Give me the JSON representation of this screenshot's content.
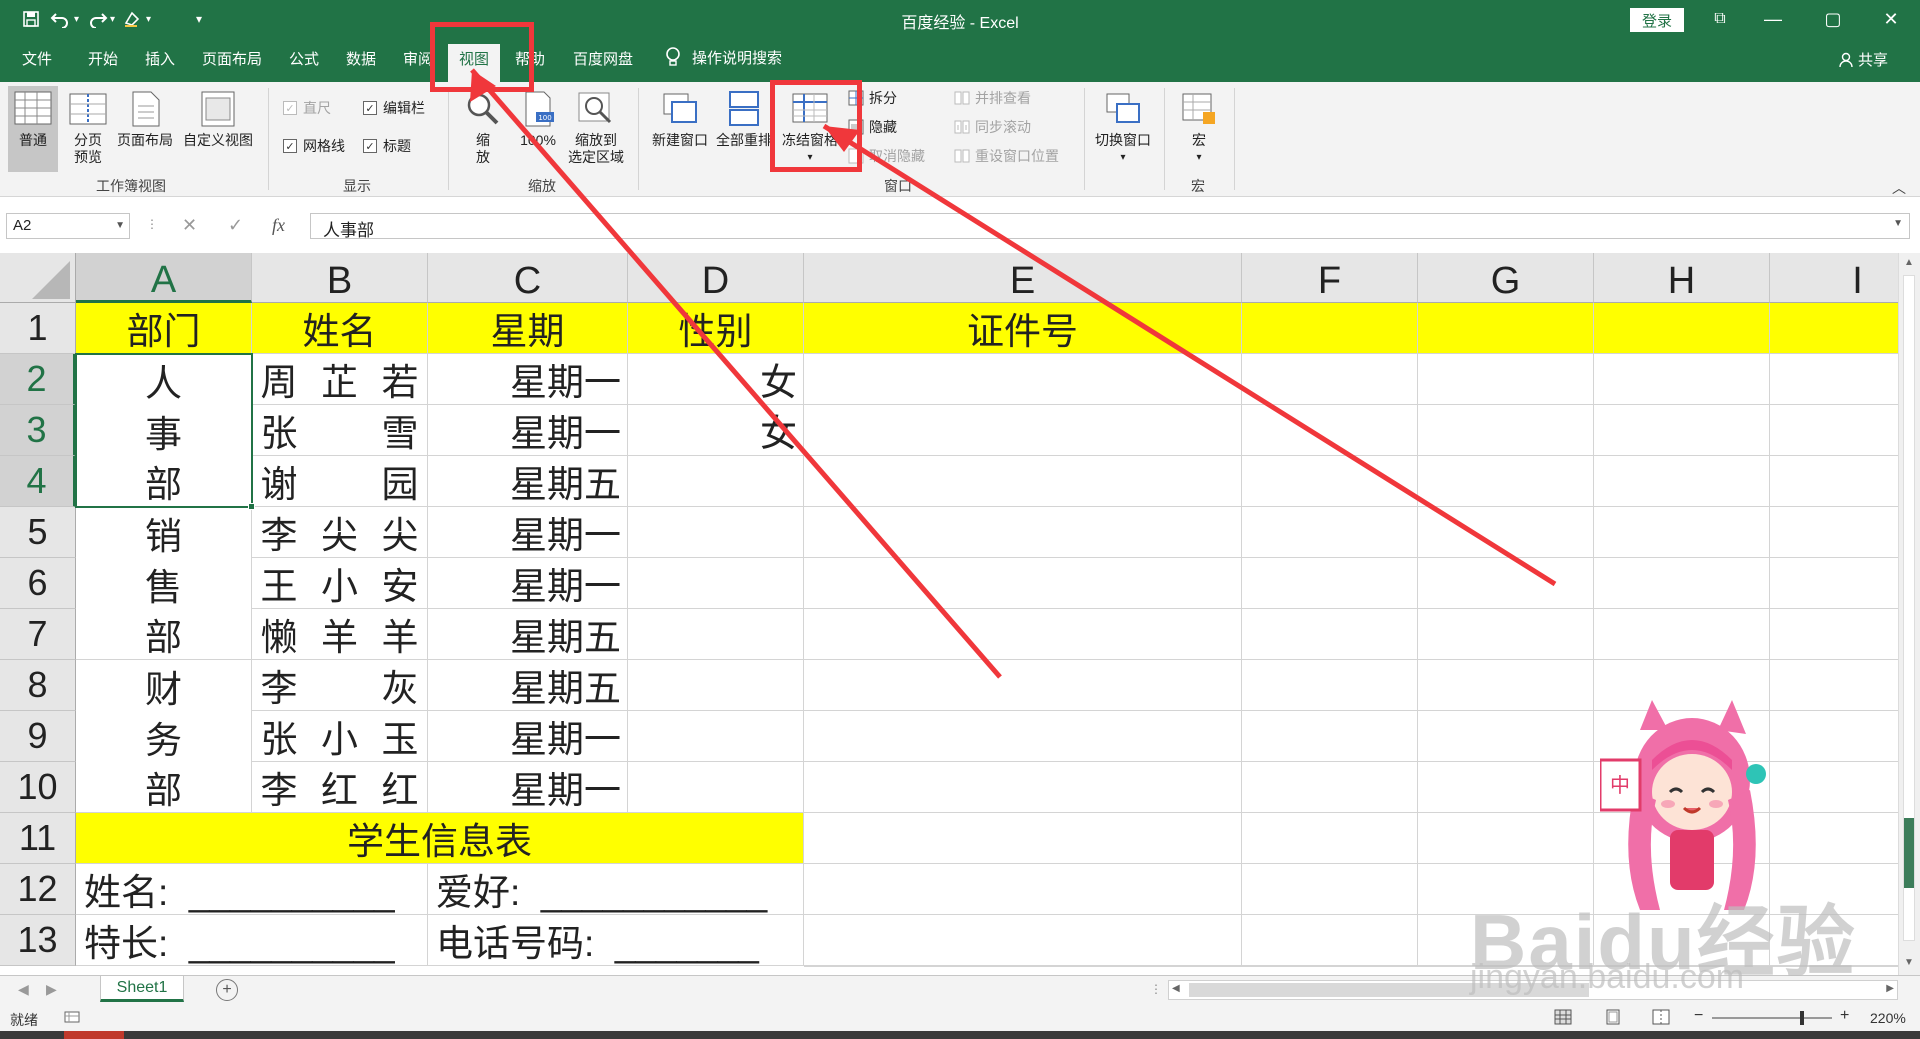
{
  "titlebar": {
    "doc_title": "百度经验  -  Excel",
    "login_label": "登录",
    "restore_icon": "⧉",
    "minimize_icon": "—",
    "maximize_icon": "▢",
    "close_icon": "✕"
  },
  "tabs": {
    "file": "文件",
    "home": "开始",
    "insert": "插入",
    "page_layout": "页面布局",
    "formulas": "公式",
    "data": "数据",
    "review": "审阅",
    "view": "视图",
    "help": "帮助",
    "baidu_pan": "百度网盘",
    "tell_me": "操作说明搜索",
    "share": "共享"
  },
  "ribbon": {
    "workbook_views": {
      "normal": "普通",
      "page_break_line1": "分页",
      "page_break_line2": "预览",
      "page_layout": "页面布局",
      "custom_views": "自定义视图",
      "group_label": "工作簿视图"
    },
    "show": {
      "ruler": "直尺",
      "formula_bar": "编辑栏",
      "gridlines": "网格线",
      "headings": "标题",
      "group_label": "显示"
    },
    "zoom": {
      "zoom_line1": "缩",
      "zoom_line2": "放",
      "hundred": "100%",
      "zoom_sel_line1": "缩放到",
      "zoom_sel_line2": "选定区域",
      "group_label": "缩放"
    },
    "window": {
      "new_window": "新建窗口",
      "arrange_all": "全部重排",
      "freeze_panes": "冻结窗格",
      "split": "拆分",
      "hide": "隐藏",
      "unhide": "取消隐藏",
      "side_by_side": "并排查看",
      "sync_scroll": "同步滚动",
      "reset_position": "重设窗口位置",
      "switch_windows": "切换窗口",
      "group_label": "窗口"
    },
    "macros": {
      "macros": "宏",
      "group_label": "宏"
    }
  },
  "formula_bar": {
    "name_box": "A2",
    "cancel_icon": "✕",
    "enter_icon": "✓",
    "fx_icon": "fx",
    "content": "人事部"
  },
  "sheet": {
    "columns": [
      "A",
      "B",
      "C",
      "D",
      "E",
      "F",
      "G",
      "H",
      "I"
    ],
    "rows": [
      "1",
      "2",
      "3",
      "4",
      "5",
      "6",
      "7",
      "8",
      "9",
      "10",
      "11",
      "12",
      "13"
    ],
    "header": {
      "a": "部门",
      "b": "姓名",
      "c": "星期",
      "d": "性别",
      "e": "证件号"
    },
    "dept_chars": [
      "人",
      "事",
      "部",
      "销",
      "售",
      "部",
      "财",
      "务",
      "部"
    ],
    "names": [
      [
        "周",
        "芷",
        "若"
      ],
      [
        "张",
        "",
        "雪"
      ],
      [
        "谢",
        "",
        "园"
      ],
      [
        "李",
        "尖",
        "尖"
      ],
      [
        "王",
        "小",
        "安"
      ],
      [
        "懒",
        "羊",
        "羊"
      ],
      [
        "李",
        "",
        "灰"
      ],
      [
        "张",
        "小",
        "玉"
      ],
      [
        "李",
        "红",
        "红"
      ]
    ],
    "weekdays": [
      "星期一",
      "星期一",
      "星期五",
      "星期一",
      "星期一",
      "星期五",
      "星期五",
      "星期一",
      "星期一"
    ],
    "genders": [
      "女",
      "女",
      "",
      "",
      "",
      "",
      "",
      "",
      ""
    ],
    "row11_title": "学生信息表",
    "row12_left": "姓名:  __________",
    "row12_right": "爱好:  ___________",
    "row13_left": "特长:  __________",
    "row13_right": "电话号码:  _______"
  },
  "sheet_tabs": {
    "sheet1": "Sheet1",
    "add": "+"
  },
  "status": {
    "ready": "就绪",
    "zoom": "220%"
  },
  "watermark": {
    "brand": "Baidu经验",
    "url": "jingyan.baidu.com",
    "mascot_badge": "中"
  },
  "colors": {
    "accent": "#217346",
    "highlight": "#ffff00",
    "annotation": "#f0373b"
  }
}
